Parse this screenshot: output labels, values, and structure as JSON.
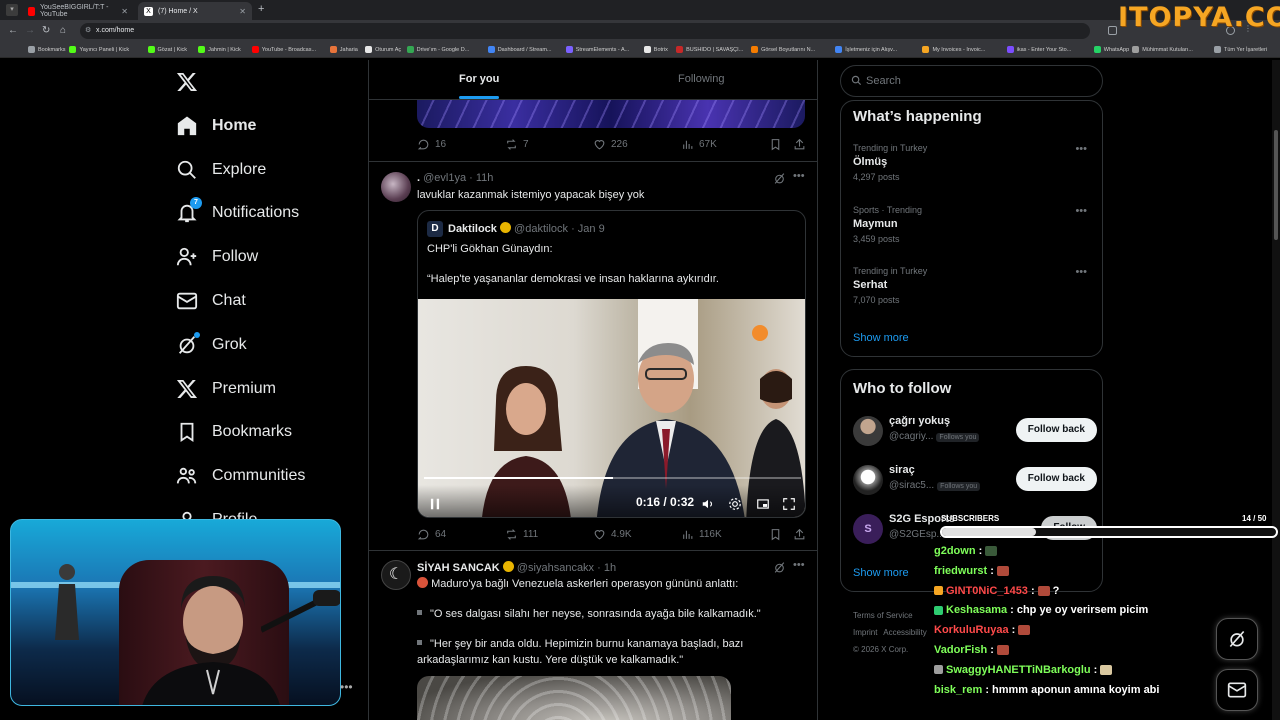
{
  "browser": {
    "tabs": [
      {
        "label": "YouSeeBIGGIRL/T:T - YouTube",
        "color": "#ff0000"
      },
      {
        "label": "(7) Home / X",
        "color": "#ffffff"
      }
    ],
    "url": "x.com/home",
    "bookmarks": [
      {
        "label": "Bookmarks",
        "color": "#9aa0a6"
      },
      {
        "label": "Yayıncı Paneli | Kick",
        "color": "#53fc18"
      },
      {
        "label": "Gözat | Kick",
        "color": "#53fc18"
      },
      {
        "label": "Jahmin | Kick",
        "color": "#53fc18"
      },
      {
        "label": "YouTube - Broadcas...",
        "color": "#ff0000"
      },
      {
        "label": "Jaharia",
        "color": "#e8743b"
      },
      {
        "label": "Oturum Aç",
        "color": "#e8e8e8"
      },
      {
        "label": "Drive'ım - Google D...",
        "color": "#34a853"
      },
      {
        "label": "Dashboard / Stream...",
        "color": "#4285f4"
      },
      {
        "label": "StreamElements - A...",
        "color": "#7b61ff"
      },
      {
        "label": "Botrix",
        "color": "#e8e8e8"
      },
      {
        "label": "BUSHIDO | SAVAŞÇI...",
        "color": "#c62828"
      },
      {
        "label": "Görsel Boyutlarını N...",
        "color": "#f57c00"
      },
      {
        "label": "İşletmeniz için Alışv...",
        "color": "#4285f4"
      },
      {
        "label": "My Invoices - Invoic...",
        "color": "#f6a623"
      },
      {
        "label": "ikas - Enter Your Sto...",
        "color": "#7c4dff"
      },
      {
        "label": "WhatsApp",
        "color": "#25d366"
      },
      {
        "label": "Mühimmat Kutuları...",
        "color": "#9e9e9e"
      },
      {
        "label": "Tüm Yer İşaretleri",
        "color": "#9aa0a6"
      }
    ]
  },
  "watermark": "ITOPYA.COM",
  "nav": {
    "items": [
      {
        "label": "Home",
        "icon": "home-icon"
      },
      {
        "label": "Explore",
        "icon": "search-icon"
      },
      {
        "label": "Notifications",
        "icon": "bell-icon",
        "badge": "7"
      },
      {
        "label": "Follow",
        "icon": "person-plus-icon"
      },
      {
        "label": "Chat",
        "icon": "envelope-icon"
      },
      {
        "label": "Grok",
        "icon": "grok-icon"
      },
      {
        "label": "Premium",
        "icon": "x-logo-icon"
      },
      {
        "label": "Bookmarks",
        "icon": "bookmark-icon"
      },
      {
        "label": "Communities",
        "icon": "people-icon"
      },
      {
        "label": "Profile",
        "icon": "profile-icon"
      }
    ]
  },
  "feed": {
    "tabs": {
      "for_you": "For you",
      "following": "Following"
    },
    "top_post_stats": {
      "replies": "16",
      "reposts": "7",
      "likes": "226",
      "views": "67K"
    },
    "post1": {
      "name": ".",
      "handle": "@evl1ya",
      "time": "11h",
      "text": "lavuklar kazanmak istemiyo yapacak bişey yok",
      "quote": {
        "name": "Daktilock",
        "handle": "@daktilock",
        "date": "Jan 9",
        "line1": "CHP'li Gökhan Günaydın:",
        "line2": "“Halep'te yaşananlar demokrasi ve insan haklarına aykırıdır.",
        "video_time": "0:16 / 0:32",
        "video_progress": 0.5
      },
      "stats": {
        "replies": "64",
        "reposts": "111",
        "likes": "4.9K",
        "views": "116K"
      }
    },
    "post2": {
      "name": "SİYAH SANCAK",
      "handle": "@siyahsancakx",
      "time": "1h",
      "line1": "Maduro'ya bağlı Venezuela askerleri operasyon gününü anlattı:",
      "line2": "\"O ses dalgası silahı her neyse, sonrasında ayağa bile kalkamadık.\"",
      "line3": "\"Her şey bir anda oldu. Hepimizin burnu kanamaya başladı, bazı",
      "line4": "arkadaşlarımız kan kustu. Yere düştük ve kalkamadık.\""
    }
  },
  "sidebar": {
    "search_placeholder": "Search",
    "happening_title": "What’s happening",
    "trends": [
      {
        "context": "Trending in Turkey",
        "topic": "Ölmüş",
        "count": "4,297 posts"
      },
      {
        "context": "Sports · Trending",
        "topic": "Maymun",
        "count": "3,459 posts"
      },
      {
        "context": "Trending in Turkey",
        "topic": "Serhat",
        "count": "7,070 posts"
      }
    ],
    "show_more": "Show more",
    "wtf_title": "Who to follow",
    "who_to_follow": [
      {
        "name": "çağrı yokuş",
        "handle": "@cagriy...",
        "follows_you": "Follows you",
        "button": "Follow back",
        "color": "#5c5c5c"
      },
      {
        "name": "siraç",
        "handle": "@sirac5...",
        "follows_you": "Follows you",
        "button": "Follow back",
        "color": "#e0e0e0"
      },
      {
        "name": "S2G Esports",
        "handle": "@S2GEsp...",
        "follows_you": "",
        "button": "Follow",
        "color": "#3a1e5a"
      }
    ],
    "wtf_show_more": "Show more",
    "footer": {
      "terms": "Terms of Service",
      "imprint": "Imprint",
      "accessibility": "Accessibility",
      "copyright": "© 2026 X Corp."
    }
  },
  "stream": {
    "subs_label": "SUBSCRIBERS",
    "subs_count": "14 / 50",
    "subs_progress": 0.28,
    "chat": [
      {
        "user": "g2down",
        "color": "#7fff5a",
        "msg": "",
        "emote": "#3a5a3a"
      },
      {
        "user": "friedwurst",
        "color": "#7fff5a",
        "msg": "",
        "emote": "#b04a3a"
      },
      {
        "user": "GINT0NiC_1453",
        "color": "#ff4a4a",
        "msg": "?",
        "emote": "#b04a3a",
        "badge": "#f6a623"
      },
      {
        "user": "Keshasama",
        "color": "#7fff5a",
        "msg": "chp ye oy verirsem picim",
        "emote": "",
        "badge": "#2ecc71"
      },
      {
        "user": "KorkuluRuyaa",
        "color": "#ff4a4a",
        "msg": "",
        "emote": "#b04a3a"
      },
      {
        "user": "VadorFish",
        "color": "#7fff5a",
        "msg": "",
        "emote": "#b04a3a"
      },
      {
        "user": "SwaggyHANETTiNBarkoglu",
        "color": "#7fff5a",
        "msg": "",
        "emote": "#d9c8a0",
        "badge": "#9e9e9e"
      },
      {
        "user": "bisk_rem",
        "color": "#7fff5a",
        "msg": "hmmm aponun amına koyim abi",
        "emote": ""
      }
    ]
  }
}
